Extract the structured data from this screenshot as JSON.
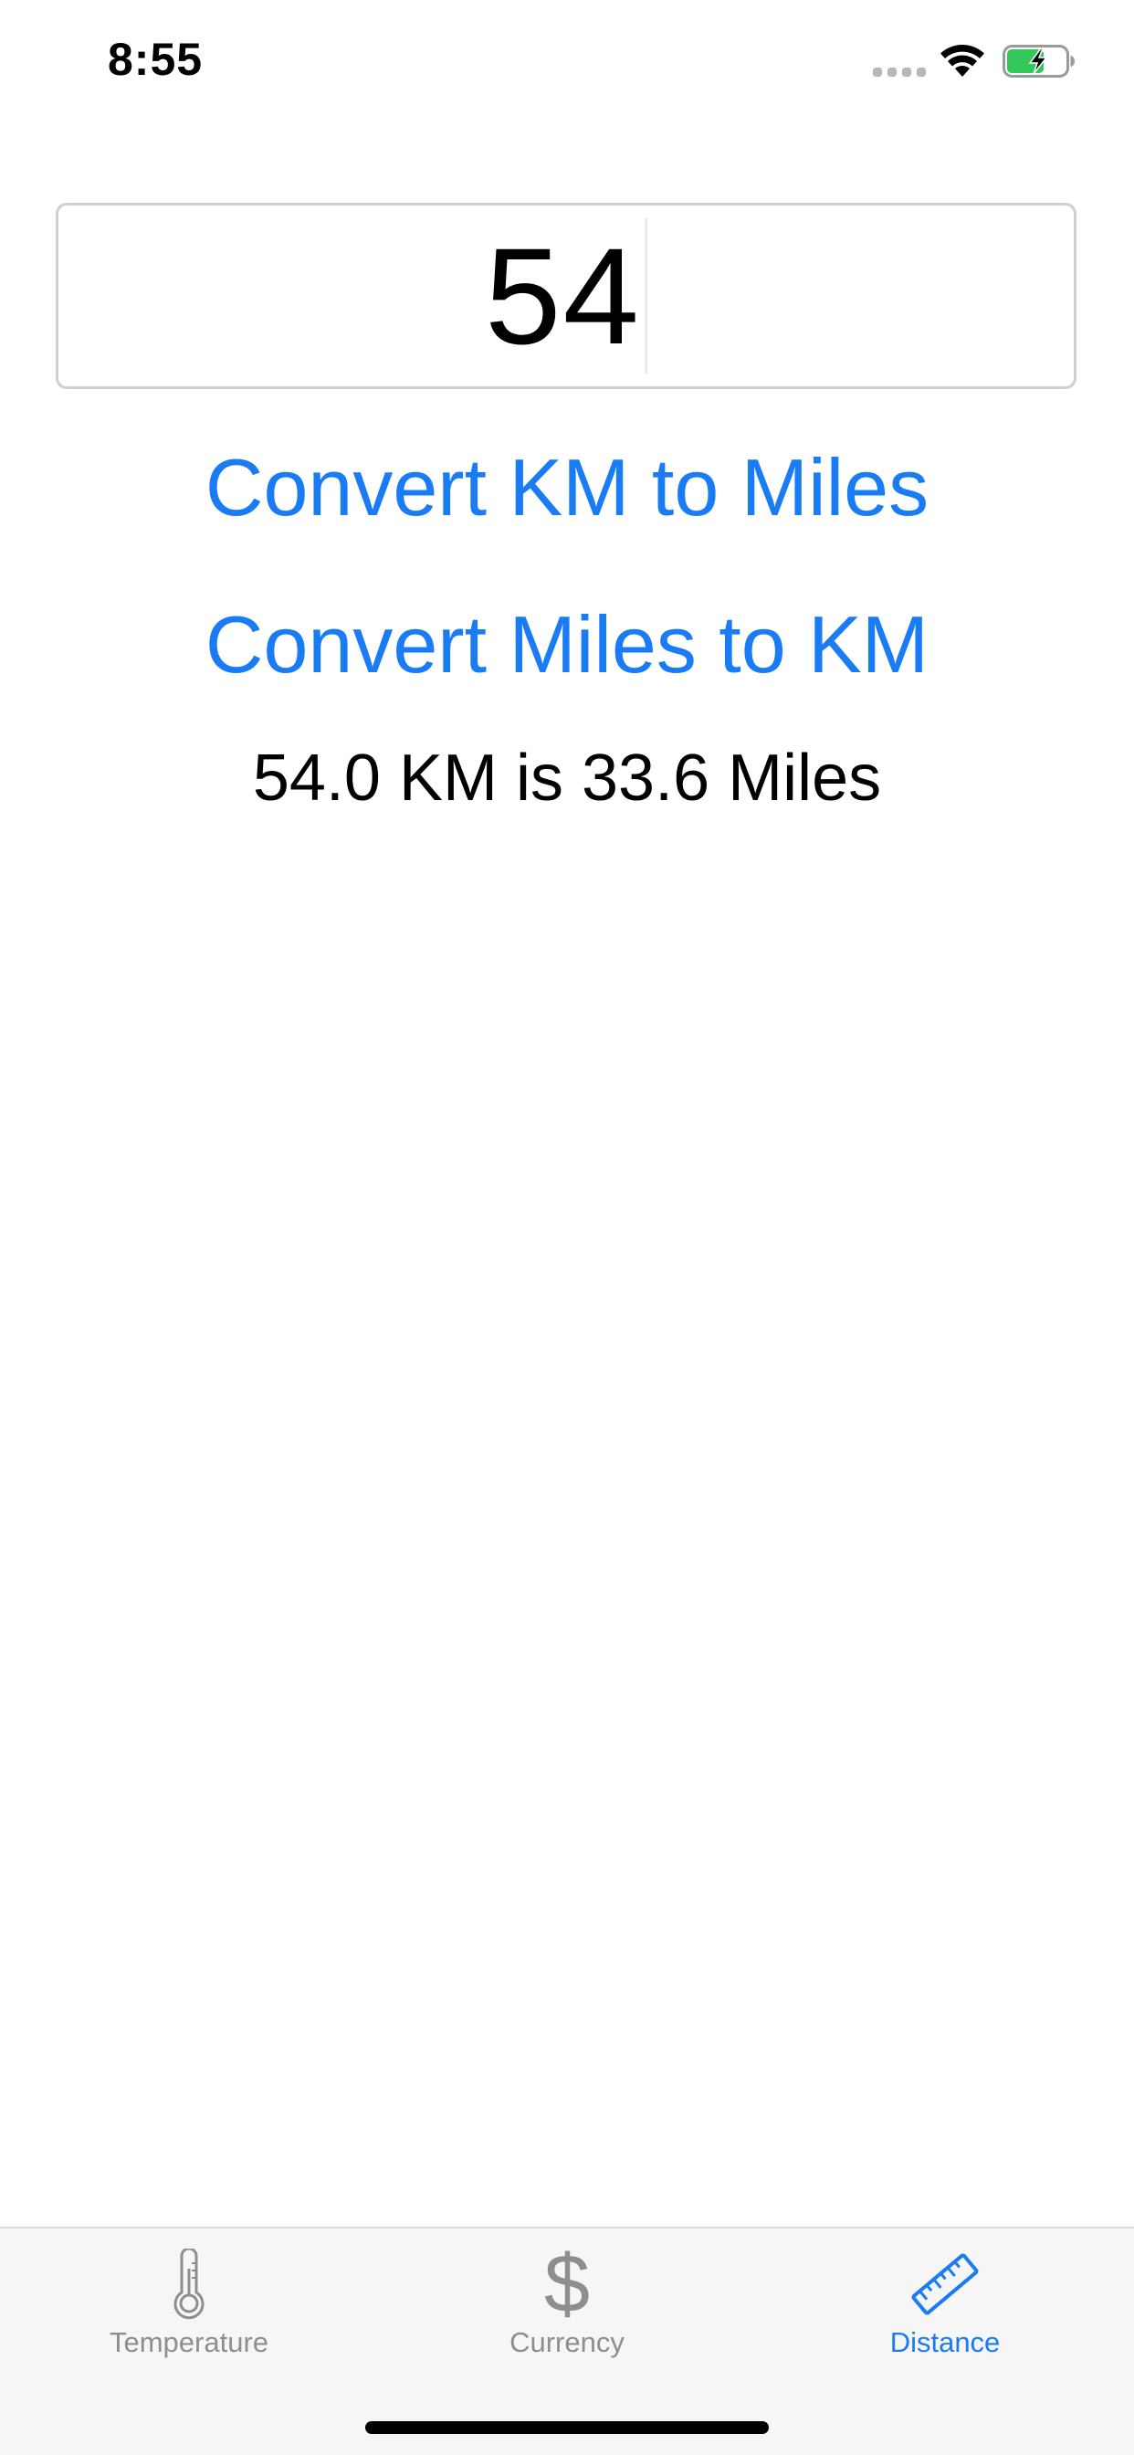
{
  "status_bar": {
    "time": "8:55",
    "icons": [
      "signal-dots-icon",
      "wifi-icon",
      "battery-charging-icon"
    ],
    "battery_color": "#34c759"
  },
  "input": {
    "value": "54"
  },
  "buttons": {
    "km_to_miles": "Convert KM to Miles",
    "miles_to_km": "Convert Miles to KM"
  },
  "result": {
    "text": "54.0 KM is 33.6 Miles"
  },
  "tab_bar": {
    "selected": "Distance",
    "tabs": [
      {
        "label": "Temperature",
        "icon": "thermometer-icon"
      },
      {
        "label": "Currency",
        "icon": "dollar-icon",
        "glyph": "$"
      },
      {
        "label": "Distance",
        "icon": "ruler-icon"
      }
    ]
  },
  "colors": {
    "accent": "#1a7cf5",
    "inactive_tab": "#8e8e8e",
    "tab_bar_background": "#f6f6f6",
    "field_border": "#cfcfcf"
  }
}
